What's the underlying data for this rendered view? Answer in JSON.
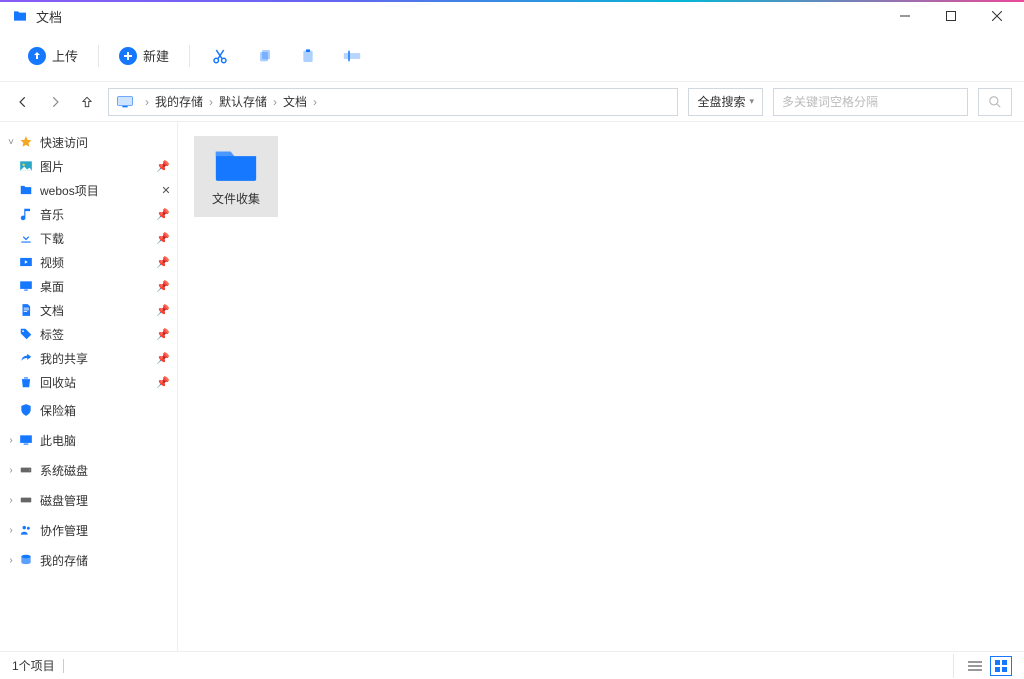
{
  "window": {
    "title": "文档"
  },
  "toolbar": {
    "upload": "上传",
    "new": "新建"
  },
  "breadcrumb": [
    "我的存储",
    "默认存储",
    "文档"
  ],
  "search": {
    "scope": "全盘搜索",
    "placeholder": "多关键词空格分隔"
  },
  "sidebar": {
    "quickAccess": "快速访问",
    "items": [
      {
        "label": "图片",
        "pinned": true,
        "ico": "picture"
      },
      {
        "label": "webos项目",
        "pinned": false,
        "closeable": true,
        "ico": "folder"
      },
      {
        "label": "音乐",
        "pinned": true,
        "ico": "music"
      },
      {
        "label": "下载",
        "pinned": true,
        "ico": "download"
      },
      {
        "label": "视频",
        "pinned": true,
        "ico": "video"
      },
      {
        "label": "桌面",
        "pinned": true,
        "ico": "desktop"
      },
      {
        "label": "文档",
        "pinned": true,
        "ico": "doc"
      },
      {
        "label": "标签",
        "pinned": true,
        "ico": "tag"
      },
      {
        "label": "我的共享",
        "pinned": true,
        "ico": "share"
      },
      {
        "label": "回收站",
        "pinned": true,
        "ico": "trash"
      }
    ],
    "safe": "保险箱",
    "thisPC": "此电脑",
    "sysdisk": "系统磁盘",
    "diskmgmt": "磁盘管理",
    "collab": "协作管理",
    "mystorage": "我的存储"
  },
  "content": {
    "folders": [
      {
        "name": "文件收集"
      }
    ]
  },
  "status": {
    "count": "1个项目"
  }
}
